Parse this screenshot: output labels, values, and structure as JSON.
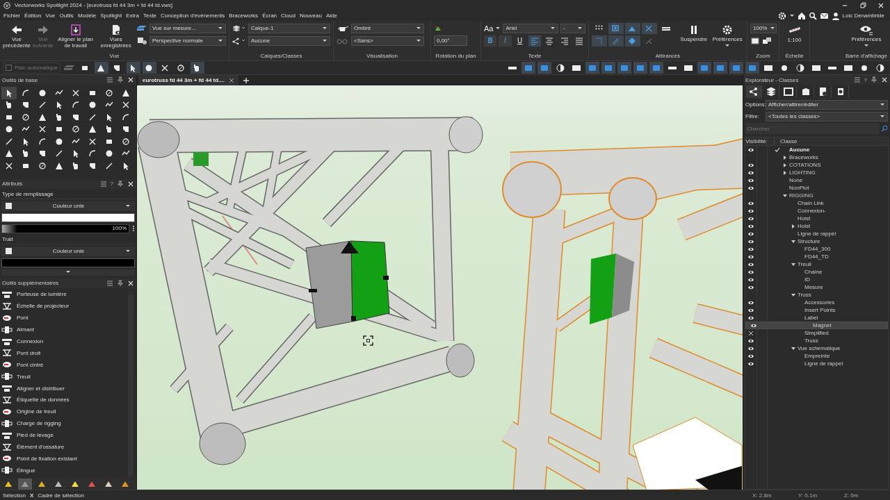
{
  "window": {
    "title": "Vectorworks Spotlight 2024 - [eurotruss fd 44 3m + fd 44 td.vwx]"
  },
  "menu": [
    "Fichier",
    "Édition",
    "Vue",
    "Outils",
    "Modèle",
    "Spotlight",
    "Extra",
    "Texte",
    "Conception d'événements",
    "Braceworks",
    "Écran",
    "Cloud",
    "Nouveau",
    "Aide"
  ],
  "user": {
    "name": "Loic Denambride"
  },
  "ribbon": {
    "view": {
      "label": "Vue",
      "buttons": [
        {
          "label": "Vue précédente",
          "disabled": false
        },
        {
          "label": "Vue suivante",
          "disabled": true
        },
        {
          "label": "Aligner le plan de travail",
          "disabled": false
        },
        {
          "label": "Vues enregistrées",
          "disabled": false
        }
      ],
      "view_select": "Vue sur mesure...",
      "projection_select": "Perspective normale"
    },
    "layers": {
      "label": "Calques/Classes",
      "layer": "Calque-1",
      "class": "Aucune"
    },
    "render": {
      "label": "Visualisation",
      "mode": "Ombré",
      "lighting": "<Sans>"
    },
    "rotation": {
      "label": "Rotation du plan",
      "value": "0,00°"
    },
    "text": {
      "label": "Texte",
      "font_glyph": "Aa",
      "font": "Ariel",
      "size": "-",
      "styles": [
        "B",
        "I",
        "U"
      ],
      "alignments": [
        {
          "selected": true
        },
        {
          "selected": false
        },
        {
          "selected": false
        },
        {
          "selected": false
        }
      ]
    },
    "snaps": {
      "label": "Attirances",
      "items": [
        {
          "on": false
        },
        {
          "on": true
        },
        {
          "on": true
        },
        {
          "on": true
        },
        {
          "on": false
        },
        {
          "on": true
        },
        {
          "on": true
        },
        {
          "on": true
        },
        {
          "on": false
        }
      ],
      "suspend": "Suspendre",
      "preferences": "Préférences"
    },
    "zoom": {
      "label": "Zoom",
      "value": "100%"
    },
    "scale": {
      "label": "Échelle",
      "value": "1:100"
    },
    "display": {
      "label": "Barre d'affichage",
      "preferences": "Préférences"
    }
  },
  "toolbar": {
    "auto_plane": {
      "label": "Plan automatique",
      "checked": false,
      "disabled": true
    },
    "modes": [
      {
        "selected": false
      },
      {
        "selected": true
      },
      {
        "selected": false
      },
      {
        "selected": true
      },
      {
        "selected": true
      },
      {
        "selected": false
      },
      {
        "selected": false
      },
      {
        "selected": true
      }
    ],
    "view_buttons": [
      {
        "on": false
      },
      {
        "on": true
      },
      {
        "on": true
      },
      {
        "on": false
      },
      {
        "on": false
      },
      {
        "on": true
      },
      {
        "on": true
      },
      {
        "on": true
      },
      {
        "on": true
      },
      {
        "on": true
      },
      {
        "on": false
      },
      {
        "on": false
      },
      {
        "on": true
      },
      {
        "on": true
      },
      {
        "on": true
      },
      {
        "on": true
      },
      {
        "on": false
      },
      {
        "on": false
      },
      {
        "on": false
      },
      {
        "on": false
      },
      {
        "on": false
      },
      {
        "on": false
      },
      {
        "on": false
      },
      {
        "on": false
      }
    ]
  },
  "doc_tabs": [
    {
      "label": "eurotruss fd 44 3m + fd 44 td....",
      "selected": true
    }
  ],
  "basic_tools": {
    "title": "Outils de base",
    "tools": [
      {
        "selected": true
      },
      {
        "selected": false
      },
      {
        "selected": false
      },
      {
        "selected": false
      },
      {
        "selected": false
      },
      {
        "selected": false
      },
      {
        "selected": false
      },
      {
        "selected": false
      },
      {
        "selected": false
      },
      {
        "selected": false
      },
      {
        "selected": false
      },
      {
        "selected": false
      },
      {
        "selected": false
      },
      {
        "selected": false
      },
      {
        "selected": false
      },
      {
        "selected": false
      },
      {
        "selected": false
      },
      {
        "selected": false
      },
      {
        "selected": false
      },
      {
        "selected": false
      },
      {
        "selected": false
      },
      {
        "selected": false
      },
      {
        "selected": false
      },
      {
        "selected": false
      },
      {
        "selected": false
      },
      {
        "selected": false
      },
      {
        "selected": false
      },
      {
        "selected": false
      },
      {
        "selected": false
      },
      {
        "selected": false
      },
      {
        "selected": false
      },
      {
        "selected": false
      },
      {
        "selected": false
      },
      {
        "selected": false
      },
      {
        "selected": false
      },
      {
        "selected": false
      },
      {
        "selected": false
      },
      {
        "selected": false
      },
      {
        "selected": false
      },
      {
        "selected": false
      },
      {
        "selected": false
      },
      {
        "selected": false
      },
      {
        "selected": false
      },
      {
        "selected": false
      },
      {
        "selected": false
      },
      {
        "selected": false
      },
      {
        "selected": false
      },
      {
        "selected": false
      },
      {
        "selected": false
      },
      {
        "selected": false
      },
      {
        "selected": false
      },
      {
        "selected": false
      },
      {
        "selected": false
      },
      {
        "selected": false
      },
      {
        "selected": false
      },
      {
        "selected": false
      }
    ]
  },
  "attributes": {
    "title": "Attributs",
    "help": "?",
    "fill_label": "Type de remplissage",
    "fill_type": "Couleur unie",
    "opacity": "100%",
    "stroke_label": "Trait",
    "stroke_type": "Couleur unie"
  },
  "extra_tools": {
    "title": "Outils supplémentaires",
    "items": [
      "Porteuse de lumière",
      "Échelle de projecteur",
      "Pont",
      "Aimant",
      "Connexion",
      "Pont droit",
      "Pont cintré",
      "Treuil",
      "Aligner et distribuer",
      "Étiquette de données",
      "Origine de treuil",
      "Charge de rigging",
      "Pied de levage",
      "Élément d'ossature",
      "Point de fixation existant",
      "Élingue"
    ]
  },
  "tool_sets": [
    {
      "selected": false
    },
    {
      "selected": true
    },
    {
      "selected": false
    },
    {
      "selected": false
    },
    {
      "selected": false
    },
    {
      "selected": false
    },
    {
      "selected": false
    },
    {
      "selected": false
    }
  ],
  "class_explorer": {
    "title": "Explorateur - Classes",
    "help": "?",
    "tabs": [
      {
        "selected": true
      },
      {
        "selected": false
      },
      {
        "selected": false
      },
      {
        "selected": false
      },
      {
        "selected": false
      },
      {
        "selected": false
      }
    ],
    "options_label": "Options:",
    "options": "Afficher/attirer/éditer",
    "filter_label": "Filtre:",
    "filter": "<Toutes les classes>",
    "search_placeholder": "Chercher",
    "columns": [
      "Visibilité",
      "Classe"
    ],
    "tree": [
      {
        "label": "Aucune",
        "visible": true,
        "hidden": false,
        "active": true,
        "selected": false
      },
      {
        "label": "Braceworks",
        "visible": false,
        "hidden": false,
        "expanded": false,
        "selected": false
      },
      {
        "label": "COTATIONS",
        "visible": true,
        "hidden": false,
        "expanded": false,
        "selected": false
      },
      {
        "label": "LIGHTING",
        "visible": true,
        "hidden": false,
        "expanded": false,
        "selected": false
      },
      {
        "label": "None",
        "visible": true,
        "hidden": false,
        "selected": false
      },
      {
        "label": "NonPlot",
        "visible": true,
        "hidden": false,
        "selected": false
      },
      {
        "label": "RIGGING",
        "visible": false,
        "hidden": false,
        "expanded": true,
        "selected": false,
        "children": [
          {
            "label": "Chain Link",
            "visible": true,
            "hidden": false,
            "selected": false
          },
          {
            "label": "Connexion-",
            "visible": true,
            "hidden": false,
            "selected": false
          },
          {
            "label": "Hoist",
            "visible": true,
            "hidden": false,
            "selected": false
          },
          {
            "label": "Hoist",
            "visible": true,
            "hidden": false,
            "expanded": false,
            "selected": false
          },
          {
            "label": "Ligne de rappel",
            "visible": true,
            "hidden": false,
            "selected": false
          },
          {
            "label": "Structure",
            "visible": true,
            "hidden": false,
            "expanded": true,
            "selected": false,
            "children": [
              {
                "label": "FD44_300",
                "visible": true,
                "hidden": false,
                "selected": false
              },
              {
                "label": "FD44_TD",
                "visible": true,
                "hidden": false,
                "selected": false
              }
            ]
          },
          {
            "label": "Treuil",
            "visible": true,
            "hidden": false,
            "expanded": true,
            "selected": false,
            "children": [
              {
                "label": "Chaine",
                "visible": true,
                "hidden": false,
                "selected": false
              },
              {
                "label": "ID",
                "visible": true,
                "hidden": false,
                "selected": false
              },
              {
                "label": "Mesure",
                "visible": true,
                "hidden": false,
                "selected": false
              }
            ]
          },
          {
            "label": "Truss",
            "visible": false,
            "hidden": false,
            "expanded": true,
            "selected": false,
            "children": [
              {
                "label": "Accessories",
                "visible": true,
                "hidden": false,
                "selected": false
              },
              {
                "label": "Insert Points",
                "visible": true,
                "hidden": false,
                "selected": false
              },
              {
                "label": "Label",
                "visible": true,
                "hidden": false,
                "selected": false
              },
              {
                "label": "Magnet",
                "visible": true,
                "hidden": false,
                "selected": true
              },
              {
                "label": "Simplified",
                "visible": false,
                "hidden": true,
                "selected": false
              },
              {
                "label": "Truss",
                "visible": true,
                "hidden": false,
                "selected": false
              }
            ]
          },
          {
            "label": "Vue schematique",
            "visible": true,
            "hidden": false,
            "expanded": true,
            "selected": false,
            "children": [
              {
                "label": "Empreinte",
                "visible": true,
                "hidden": false,
                "selected": false
              },
              {
                "label": "Ligne de rappel",
                "visible": true,
                "hidden": false,
                "selected": false
              }
            ]
          }
        ]
      }
    ]
  },
  "status_bar": {
    "tool": "Sélection",
    "separator": "X",
    "mode": "Cadre de sélection",
    "x": "X: 2.8m",
    "y": "Y: 0.1m",
    "z": "Z: 0m"
  }
}
